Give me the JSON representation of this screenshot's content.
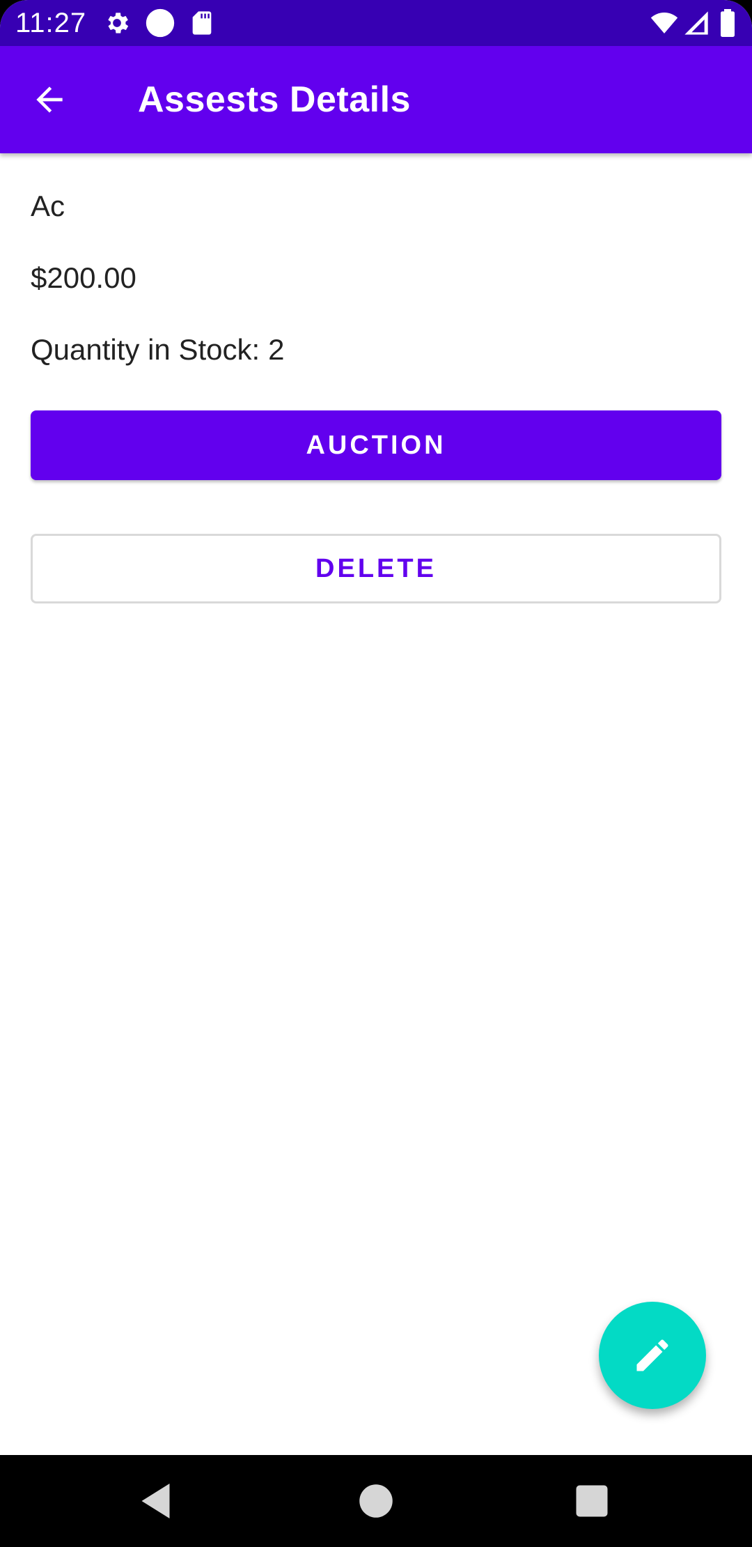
{
  "status_bar": {
    "time": "11:27",
    "icons": [
      "gear-icon",
      "circle-icon",
      "sd-card-icon",
      "wifi-icon",
      "signal-icon",
      "battery-icon"
    ]
  },
  "app_bar": {
    "title": "Assests Details",
    "back_icon": "arrow-back-icon"
  },
  "asset": {
    "name": "Ac",
    "price": "$200.00",
    "quantity_label": "Quantity in Stock:",
    "quantity_value": "2"
  },
  "actions": {
    "auction_label": "AUCTION",
    "delete_label": "DELETE"
  },
  "fab": {
    "icon": "edit-pencil-icon"
  },
  "nav_bar": {
    "icons": [
      "back-triangle-icon",
      "home-circle-icon",
      "recents-square-icon"
    ]
  },
  "colors": {
    "status_bar": "#3700b3",
    "primary": "#6200ee",
    "accent": "#03dac5",
    "background": "#ffffff",
    "nav_bar": "#000000"
  }
}
